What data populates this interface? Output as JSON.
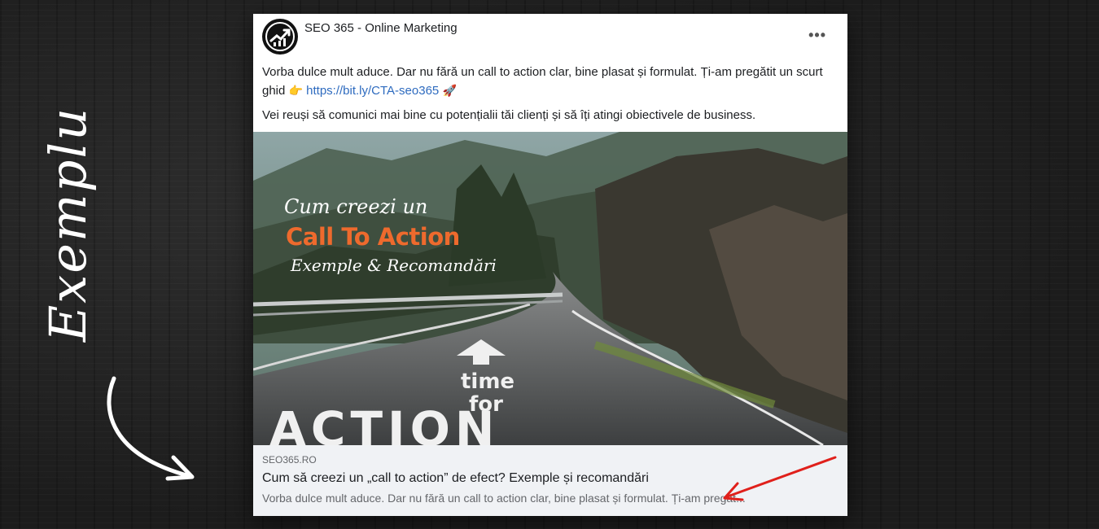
{
  "side_label": {
    "text": "Exemplu"
  },
  "post": {
    "page_name": "SEO 365 - Online Marketing",
    "more_label": "•••",
    "paragraph1_text": "Vorba dulce mult aduce. Dar nu fără un call to action clar, bine plasat și formulat. Ți-am pregătit un scurt ghid",
    "paragraph1_link": "https://bit.ly/CTA-seo365",
    "paragraph2": "Vei reuși să comunici mai bine cu potențialii tăi clienți și să îți atingi obiectivele de business."
  },
  "image": {
    "line1": "Cum creezi un",
    "line2": "Call To Action",
    "line3": "Exemple & Recomandări",
    "road_text1": "time",
    "road_text2": "for",
    "road_text3": "ACTION"
  },
  "preview": {
    "domain": "SEO365.RO",
    "title": "Cum să creezi un „call to action” de efect? Exemple și recomandări",
    "description": "Vorba dulce mult aduce. Dar nu fără un call to action clar, bine plasat și formulat. Ți-am pregăt..."
  },
  "colors": {
    "accent_orange": "#ee6a2d",
    "link_blue": "#2e6bbf",
    "arrow_red": "#e0201b"
  },
  "icons": {
    "avatar": "seo365-logo-icon",
    "pointing_emoji": "backhand-index-pointing-right-icon",
    "rocket_emoji": "rocket-icon"
  }
}
